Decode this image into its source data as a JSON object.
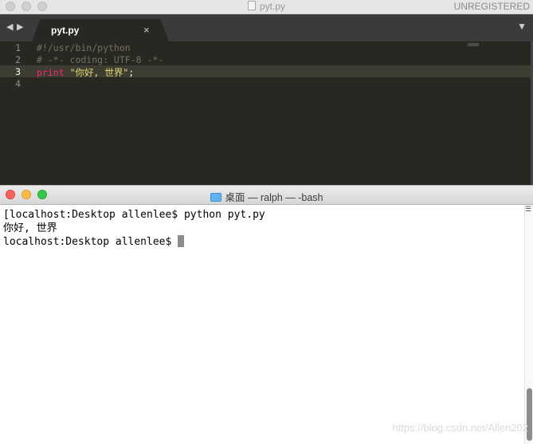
{
  "editor": {
    "title": "pyt.py",
    "license_status": "UNREGISTERED",
    "tab": {
      "label": "pyt.py",
      "close_glyph": "×"
    },
    "nav": {
      "back_glyph": "◀",
      "forward_glyph": "▶",
      "dropdown_glyph": "▼"
    },
    "line_numbers": [
      "1",
      "2",
      "3",
      "4"
    ],
    "code": {
      "line1": "#!/usr/bin/python",
      "line2": "# -*- coding: UTF-8 -*-",
      "line3_keyword": "print",
      "line3_string": "\"你好, 世界\"",
      "line3_end": ";"
    },
    "colors": {
      "background": "#272822",
      "comment": "#75715e",
      "keyword": "#f92672",
      "string": "#e6db74"
    }
  },
  "terminal": {
    "title": "桌面 — ralph — -bash",
    "lines": [
      "[localhost:Desktop allenlee$ python pyt.py",
      "你好, 世界",
      "localhost:Desktop allenlee$ "
    ],
    "menu_glyph": "☰",
    "colors": {
      "close": "#fc605b",
      "minimize": "#fdbc40",
      "maximize": "#34c84a"
    }
  },
  "watermark": "https://blog.csdn.net/Allen202"
}
